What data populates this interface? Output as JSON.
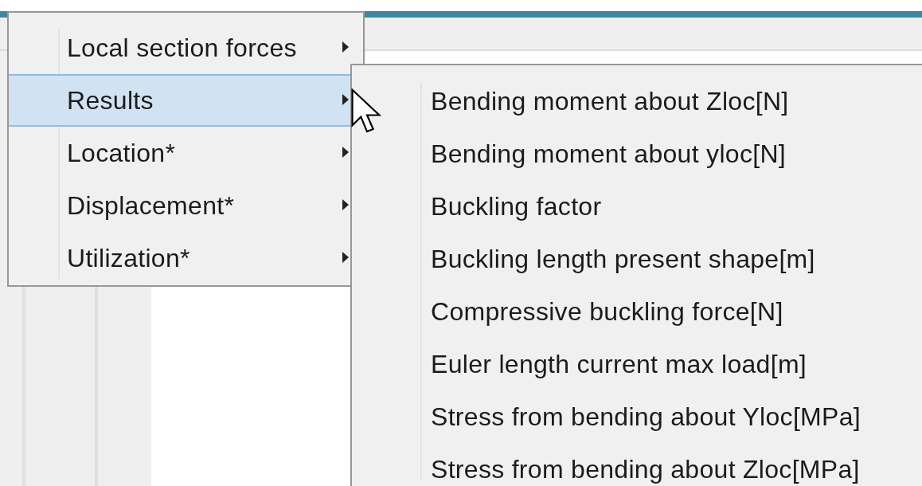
{
  "context_menu": {
    "items": [
      {
        "label": "Local section forces",
        "selected": false
      },
      {
        "label": "Results",
        "selected": true
      },
      {
        "label": "Location*",
        "selected": false
      },
      {
        "label": "Displacement*",
        "selected": false
      },
      {
        "label": "Utilization*",
        "selected": false
      }
    ]
  },
  "submenu": {
    "items": [
      {
        "label": "Bending moment about Zloc[N]"
      },
      {
        "label": "Bending moment about yloc[N]"
      },
      {
        "label": "Buckling factor"
      },
      {
        "label": "Buckling length present shape[m]"
      },
      {
        "label": "Compressive buckling force[N]"
      },
      {
        "label": "Euler length current max load[m]"
      },
      {
        "label": "Stress from bending about Yloc[MPa]"
      },
      {
        "label": "Stress from bending about Zloc[MPa]"
      }
    ]
  }
}
